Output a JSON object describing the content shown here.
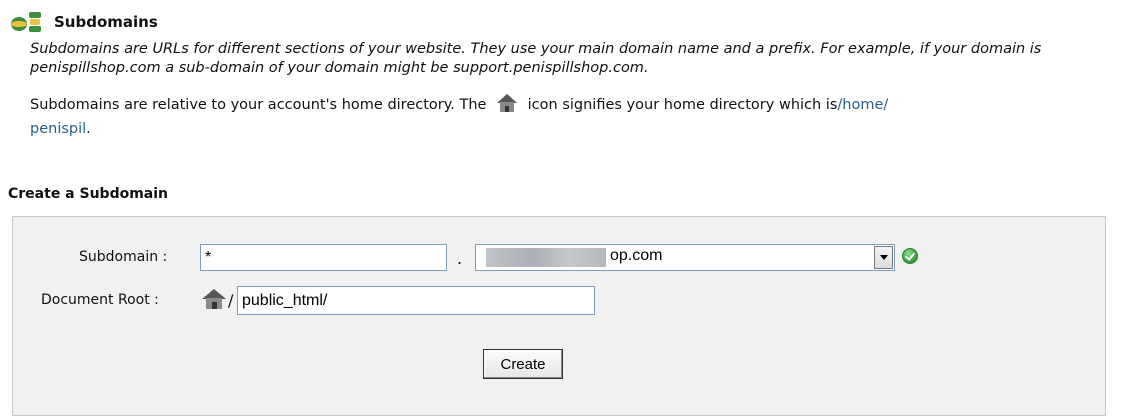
{
  "header": {
    "title": "Subdomains"
  },
  "intro": {
    "line1": "Subdomains are URLs for different sections of your website. They use your main domain name and a prefix. For example, if your domain is penispillshop.com a sub-domain of your domain might be support.penispillshop.com.",
    "relative_text_before": "Subdomains are relative to your account's home directory. The",
    "relative_text_after": "icon signifies your home directory which is",
    "home_path_link": "/home/\npenispil",
    "period": "."
  },
  "form": {
    "section_title": "Create a Subdomain",
    "subdomain_label": "Subdomain :",
    "subdomain_value": "*",
    "dot_separator": ".",
    "domain_select_value": "op.com",
    "docroot_label": "Document Root :",
    "docroot_slash": "/",
    "docroot_value": "public_html/",
    "create_button": "Create"
  },
  "colors": {
    "link": "#2a5d87",
    "panel_bg": "#f1f2f0",
    "panel_border": "#bcc8cf"
  }
}
